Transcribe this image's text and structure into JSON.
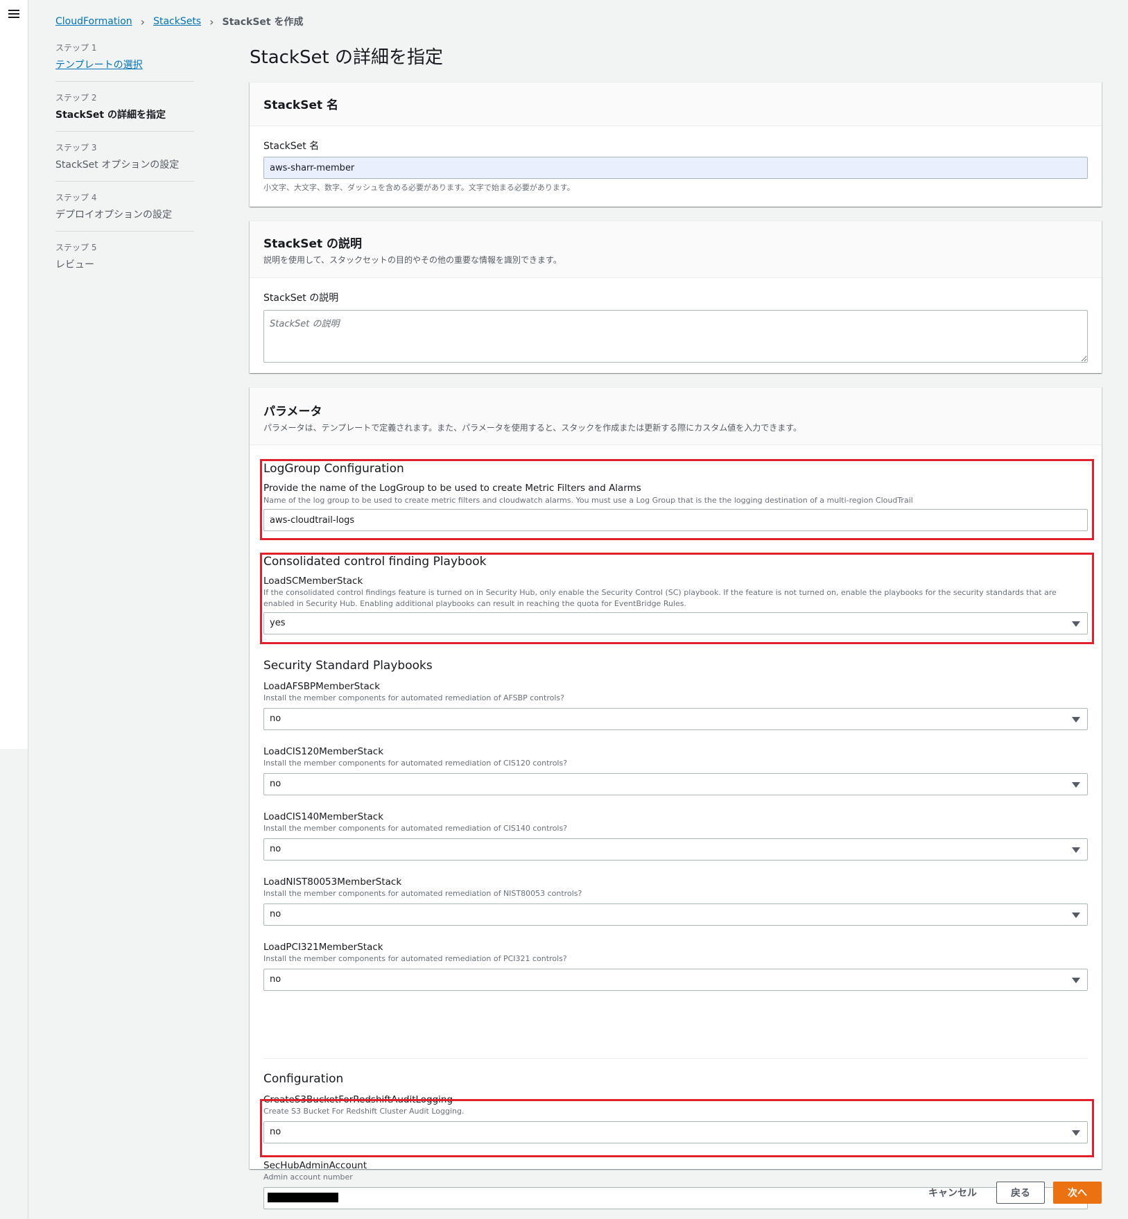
{
  "breadcrumb": {
    "items": [
      "CloudFormation",
      "StackSets"
    ],
    "current": "StackSet を作成"
  },
  "steps": [
    {
      "num": "ステップ 1",
      "label": "テンプレートの選択"
    },
    {
      "num": "ステップ 2",
      "label": "StackSet の詳細を指定"
    },
    {
      "num": "ステップ 3",
      "label": "StackSet オプションの設定"
    },
    {
      "num": "ステップ 4",
      "label": "デプロイオプションの設定"
    },
    {
      "num": "ステップ 5",
      "label": "レビュー"
    }
  ],
  "page_title": "StackSet の詳細を指定",
  "name_section": {
    "title": "StackSet 名",
    "label": "StackSet 名",
    "value": "aws-sharr-member",
    "hint": "小文字、大文字、数字、ダッシュを含める必要があります。文字で始まる必要があります。"
  },
  "desc_section": {
    "title": "StackSet の説明",
    "subtitle": "説明を使用して、スタックセットの目的やその他の重要な情報を識別できます。",
    "label": "StackSet の説明",
    "placeholder": "StackSet の説明"
  },
  "params": {
    "title": "パラメータ",
    "subtitle": "パラメータは、テンプレートで定義されます。また、パラメータを使用すると、スタックを作成または更新する際にカスタム値を入力できます。",
    "loggroup": {
      "group": "LogGroup Configuration",
      "label": "Provide the name of the LogGroup to be used to create Metric Filters and Alarms",
      "desc": "Name of the log group to be used to create metric filters and cloudwatch alarms. You must use a Log Group that is the the logging destination of a multi-region CloudTrail",
      "value": "aws-cloudtrail-logs"
    },
    "consolidated": {
      "group": "Consolidated control finding Playbook",
      "label": "LoadSCMemberStack",
      "desc": "If the consolidated control findings feature is turned on in Security Hub, only enable the Security Control (SC) playbook. If the feature is not turned on, enable the playbooks for the security standards that are enabled in Security Hub. Enabling additional playbooks can result in reaching the quota for EventBridge Rules.",
      "value": "yes"
    },
    "standards": {
      "group": "Security Standard Playbooks",
      "items": [
        {
          "label": "LoadAFSBPMemberStack",
          "desc": "Install the member components for automated remediation of AFSBP controls?",
          "value": "no"
        },
        {
          "label": "LoadCIS120MemberStack",
          "desc": "Install the member components for automated remediation of CIS120 controls?",
          "value": "no"
        },
        {
          "label": "LoadCIS140MemberStack",
          "desc": "Install the member components for automated remediation of CIS140 controls?",
          "value": "no"
        },
        {
          "label": "LoadNIST80053MemberStack",
          "desc": "Install the member components for automated remediation of NIST80053 controls?",
          "value": "no"
        },
        {
          "label": "LoadPCI321MemberStack",
          "desc": "Install the member components for automated remediation of PCI321 controls?",
          "value": "no"
        }
      ]
    },
    "configuration": {
      "group": "Configuration",
      "s3": {
        "label": "CreateS3BucketForRedshiftAuditLogging",
        "desc": "Create S3 Bucket For Redshift Cluster Audit Logging.",
        "value": "no"
      },
      "admin": {
        "label": "SecHubAdminAccount",
        "desc": "Admin account number"
      }
    }
  },
  "actions": {
    "cancel": "キャンセル",
    "back": "戻る",
    "next": "次へ"
  },
  "colors": {
    "link": "#0073bb",
    "primary": "#ec7211",
    "highlight": "#e0202c"
  }
}
